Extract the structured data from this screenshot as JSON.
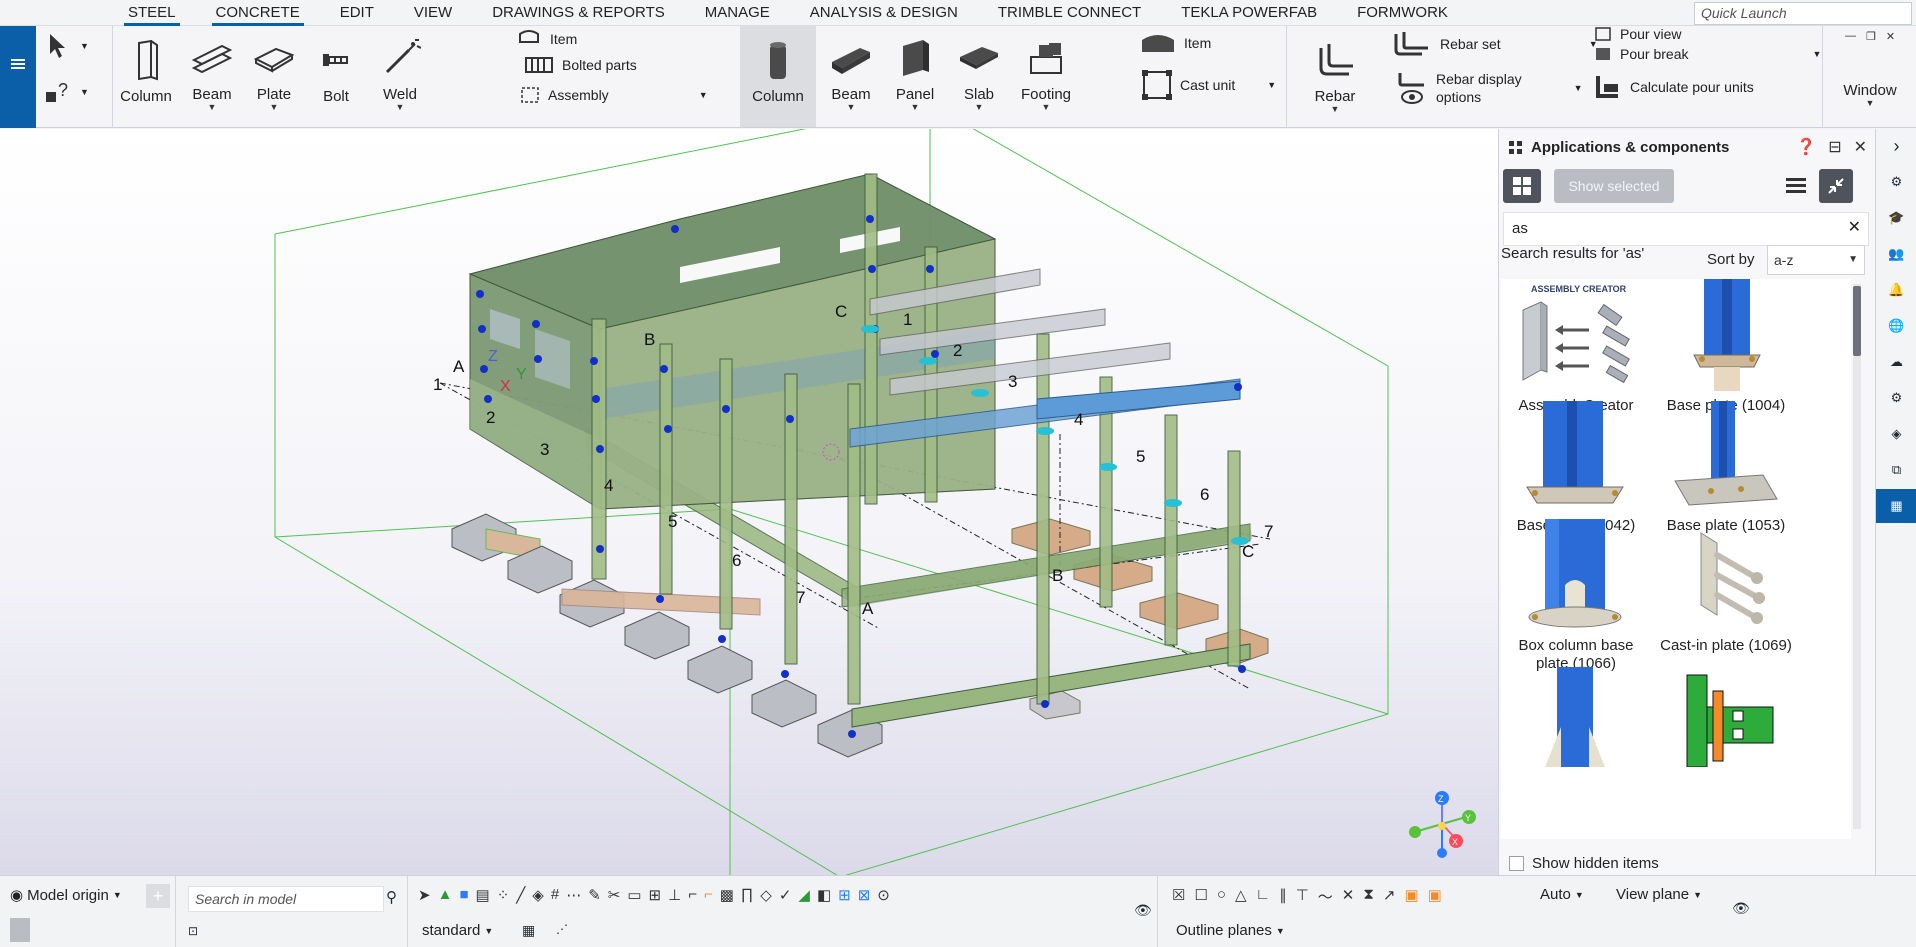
{
  "menu_icon": "hamburger-icon",
  "tabs": [
    {
      "label": "STEEL",
      "active": true
    },
    {
      "label": "CONCRETE",
      "active": true
    },
    {
      "label": "EDIT",
      "active": false
    },
    {
      "label": "VIEW",
      "active": false
    },
    {
      "label": "DRAWINGS & REPORTS",
      "active": false
    },
    {
      "label": "MANAGE",
      "active": false
    },
    {
      "label": "ANALYSIS & DESIGN",
      "active": false
    },
    {
      "label": "TRIMBLE CONNECT",
      "active": false
    },
    {
      "label": "TEKLA POWERFAB",
      "active": false
    },
    {
      "label": "FORMWORK",
      "active": false
    }
  ],
  "quick_launch": {
    "placeholder": "Quick Launch"
  },
  "ribbon": {
    "steel": {
      "column": "Column",
      "beam": "Beam",
      "plate": "Plate",
      "bolt": "Bolt",
      "weld": "Weld",
      "item": "Item",
      "bolted_parts": "Bolted parts",
      "assembly": "Assembly"
    },
    "concrete": {
      "column": "Column",
      "beam": "Beam",
      "panel": "Panel",
      "slab": "Slab",
      "footing": "Footing",
      "item": "Item",
      "cast_unit": "Cast unit",
      "rebar": "Rebar",
      "rebar_set": "Rebar set",
      "rebar_display_options_1": "Rebar display",
      "rebar_display_options_2": "options",
      "pour_view": "Pour view",
      "pour_break": "Pour break",
      "calculate_pour_units": "Calculate pour units"
    },
    "window": "Window"
  },
  "viewport": {
    "grid_letters": [
      "A",
      "B",
      "C"
    ],
    "grid_numbers": [
      "1",
      "2",
      "3",
      "4",
      "5",
      "6",
      "7"
    ],
    "axis_labels": {
      "x": "X",
      "y": "Y",
      "z": "Z"
    }
  },
  "panel": {
    "title": "Applications & components",
    "show_selected": "Show selected",
    "search_value": "as",
    "results_text": "Search results for 'as'",
    "sort_by_label": "Sort by",
    "sort_value": "a-z",
    "items": [
      {
        "label": "AssemblyCreator",
        "thumb_caption": "ASSEMBLY CREATOR"
      },
      {
        "label": "Base plate (1004)"
      },
      {
        "label": "Base plate (1042)"
      },
      {
        "label": "Base plate (1053)"
      },
      {
        "label": "Box column base plate (1066)"
      },
      {
        "label": "Cast-in plate (1069)"
      }
    ],
    "show_hidden_items": "Show hidden items"
  },
  "bottom": {
    "model_origin": "Model origin",
    "search_placeholder": "Search in model",
    "standard": "standard",
    "auto": "Auto",
    "view_plane": "View plane",
    "outline_planes": "Outline planes"
  },
  "colors": {
    "brand_blue": "#0a5fa8",
    "steel_blue": "#2f6fd0",
    "concrete_green": "#8faa6a",
    "footing_tan": "#d5ab8a"
  }
}
